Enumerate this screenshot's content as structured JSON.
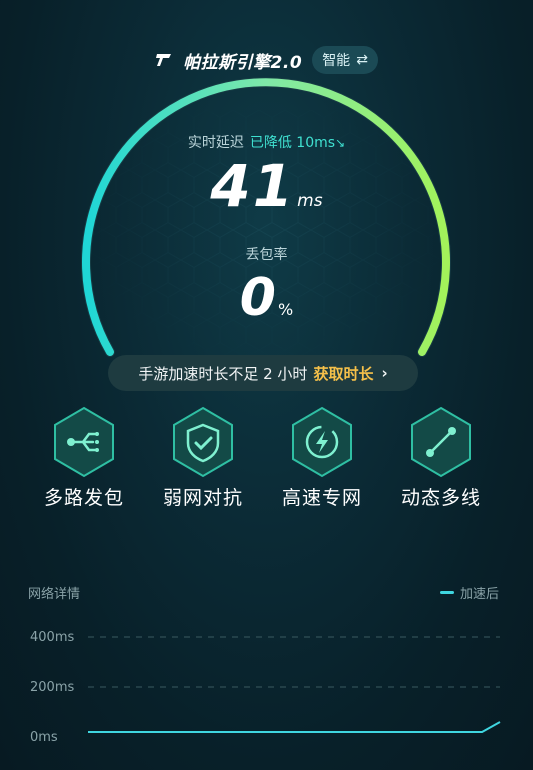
{
  "header": {
    "engine_title": "帕拉斯引擎2.0",
    "mode_label": "智能",
    "mode_icon": "swap-icon"
  },
  "latency": {
    "label": "实时延迟",
    "delta": "已降低 10ms",
    "value": "41",
    "unit": "ms"
  },
  "packet_loss": {
    "label": "丢包率",
    "value": "0",
    "unit": "%"
  },
  "notice": {
    "text": "手游加速时长不足 2 小时",
    "action": "获取时长",
    "chevron": "›"
  },
  "features": [
    {
      "label": "多路发包",
      "icon": "multipath-icon"
    },
    {
      "label": "弱网对抗",
      "icon": "shield-check-icon"
    },
    {
      "label": "高速专网",
      "icon": "bolt-icon"
    },
    {
      "label": "动态多线",
      "icon": "link-nodes-icon"
    }
  ],
  "network": {
    "title": "网络详情",
    "legend": "加速后",
    "y_ticks": [
      "400ms",
      "200ms",
      "0ms"
    ]
  },
  "chart_data": {
    "type": "line",
    "yticks": [
      "400ms",
      "200ms",
      "0ms"
    ],
    "ylim": [
      0,
      400
    ],
    "series": [
      {
        "name": "加速后",
        "values": [
          20,
          20,
          20,
          20,
          20,
          20,
          20,
          20,
          20,
          20,
          20,
          20,
          20,
          20,
          20,
          20,
          20,
          20,
          20,
          20,
          20,
          20,
          20,
          60
        ]
      }
    ]
  },
  "colors": {
    "accent_cyan": "#3fe0d0",
    "accent_green": "#a3f25a",
    "warning": "#f5c04a"
  }
}
